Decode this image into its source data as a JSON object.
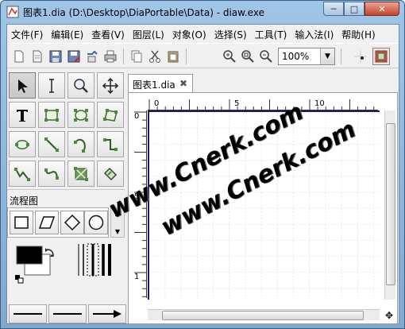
{
  "window": {
    "title": "图表1.dia (D:\\Desktop\\DiaPortable\\Data) - diaw.exe",
    "min_glyph": "─",
    "max_glyph": "□",
    "close_glyph": "✕"
  },
  "menu": [
    "文件(F)",
    "编辑(E)",
    "查看(V)",
    "图层(L)",
    "对象(O)",
    "选择(S)",
    "工具(T)",
    "输入法(I)",
    "帮助(H)"
  ],
  "toolbar": {
    "buttons": [
      "new-icon",
      "open-icon",
      "save-icon",
      "save-as-icon",
      "export-icon",
      "print-icon",
      "copy-icon",
      "cut-icon",
      "paste-icon",
      "zoom-in-icon",
      "zoom-fit-icon",
      "zoom-out-icon",
      "snap-grid-icon",
      "guides-icon"
    ],
    "zoom": "100%",
    "zoom_dropdown_glyph": "▼"
  },
  "palette": {
    "tools": [
      "pointer-tool",
      "text-edit-tool",
      "magnify-tool",
      "scroll-tool",
      "text-tool",
      "box-tool",
      "ellipse-tool",
      "polygon-tool",
      "beziergon-tool",
      "line-tool",
      "arc-tool",
      "zigzag-tool",
      "polyline-tool",
      "bezier-tool",
      "image-tool",
      "outline-tool"
    ],
    "sheet": "流程图",
    "shapes": [
      "rectangle-shape",
      "parallelogram-shape",
      "diamond-shape",
      "circle-shape"
    ],
    "scroll_up": "▲",
    "scroll_down": "▼"
  },
  "document": {
    "tab_label": "图表1.dia",
    "tab_close": "✖",
    "ruler_top_labels": [
      "0",
      "5",
      "10"
    ],
    "ruler_left_labels": [
      "0",
      "5",
      "1"
    ],
    "nav_glyph": "✥"
  },
  "watermark": {
    "line1": "www.Cnerk.com",
    "line2": "www.Cnerk.com"
  },
  "colors": {
    "accent": "#1c1c6e",
    "foreground": "#000000",
    "background": "#ffffff"
  }
}
